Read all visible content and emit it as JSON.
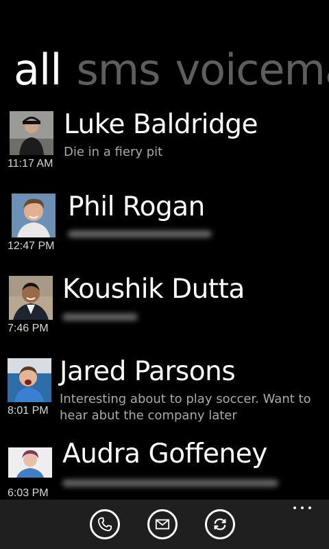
{
  "pivot": {
    "tabs": [
      {
        "label": "all",
        "active": true
      },
      {
        "label": "sms",
        "active": false
      },
      {
        "label": "voicemail",
        "active": false
      }
    ]
  },
  "messages": [
    {
      "name": "Luke Baldridge",
      "time": "11:17 AM",
      "preview": "Die in a fiery pit",
      "preview_blurred": false
    },
    {
      "name": "Phil Rogan",
      "time": "12:47 PM",
      "preview": "",
      "preview_blurred": true
    },
    {
      "name": "Koushik Dutta",
      "time": "7:46 PM",
      "preview": "",
      "preview_blurred": true
    },
    {
      "name": "Jared Parsons",
      "time": "8:01 PM",
      "preview": "Interesting about to play soccer. Want to hear abut the company later",
      "preview_blurred": false
    },
    {
      "name": "Audra Goffeney",
      "time": "6:03 PM",
      "preview": "",
      "preview_blurred": true
    }
  ],
  "appbar": {
    "buttons": [
      {
        "icon": "phone-icon"
      },
      {
        "icon": "mail-icon"
      },
      {
        "icon": "sync-icon"
      }
    ],
    "more_icon": "ellipsis-icon"
  },
  "colors": {
    "background": "#000000",
    "active_text": "#ffffff",
    "inactive_pivot": "#5e5e5e",
    "secondary_text": "#aaaaaa",
    "appbar": "#1f1f1f"
  }
}
